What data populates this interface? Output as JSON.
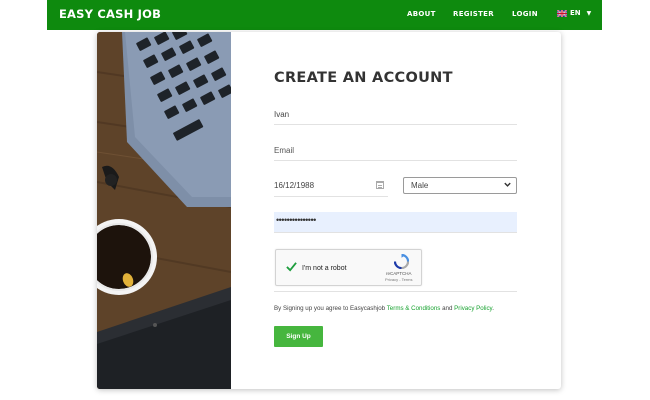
{
  "navbar": {
    "brand": "EASY CASH JOB",
    "links": [
      "ABOUT",
      "REGISTER",
      "LOGIN"
    ],
    "language": "EN"
  },
  "form": {
    "title": "CREATE AN ACCOUNT",
    "name_value": "Ivan",
    "email_placeholder": "Email",
    "dob_value": "16/12/1988",
    "gender_value": "Male",
    "password_masked": "•••••••••••••••",
    "captcha": {
      "label": "I'm not a robot",
      "brand": "reCAPTCHA",
      "links": "Privacy - Terms"
    },
    "agreement": {
      "prefix": "By Signing up you agree to Easycashjob ",
      "terms": "Terms & Conditions",
      "middle": " and ",
      "privacy": "Privacy Policy",
      "suffix": "."
    },
    "submit_label": "Sign Up"
  },
  "colors": {
    "navbar": "#0e8a0e",
    "accent": "#46b63e",
    "link": "#17a22f",
    "autofill": "#e8f0fe"
  }
}
